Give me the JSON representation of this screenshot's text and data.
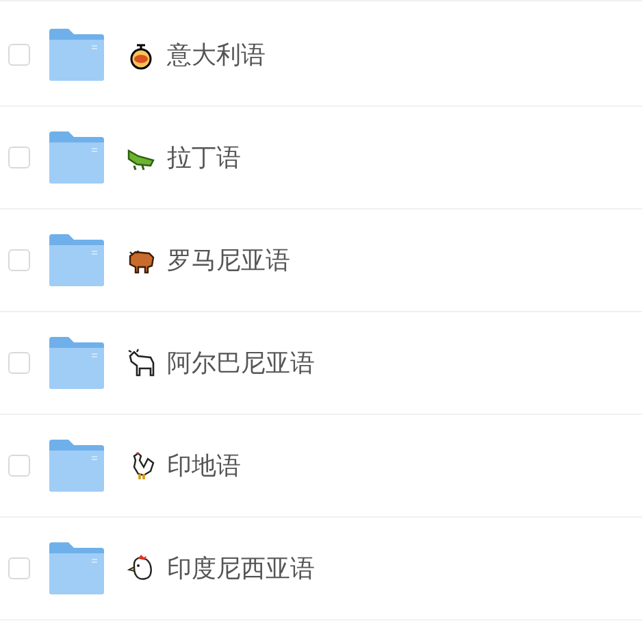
{
  "folders": [
    {
      "name": "意大利语",
      "checked": false
    },
    {
      "name": "拉丁语",
      "checked": false
    },
    {
      "name": "罗马尼亚语",
      "checked": false
    },
    {
      "name": "阿尔巴尼亚语",
      "checked": false
    },
    {
      "name": "印地语",
      "checked": false
    },
    {
      "name": "印度尼西亚语",
      "checked": false
    }
  ]
}
